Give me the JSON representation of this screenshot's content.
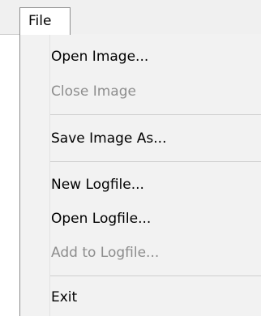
{
  "menubar": {
    "file_label": "File"
  },
  "menu": {
    "items": [
      {
        "label": "Open Image...",
        "enabled": true
      },
      {
        "label": "Close Image",
        "enabled": false
      },
      {
        "label": "Save Image As...",
        "enabled": true
      },
      {
        "label": "New Logfile...",
        "enabled": true
      },
      {
        "label": "Open Logfile...",
        "enabled": true
      },
      {
        "label": "Add to Logfile...",
        "enabled": false
      },
      {
        "label": "Exit",
        "enabled": true
      }
    ]
  },
  "colors": {
    "enabled_text": "#000000",
    "disabled_text": "#8d8d8d",
    "menu_background": "#f2f2f2",
    "separator": "#cfcfcf"
  }
}
